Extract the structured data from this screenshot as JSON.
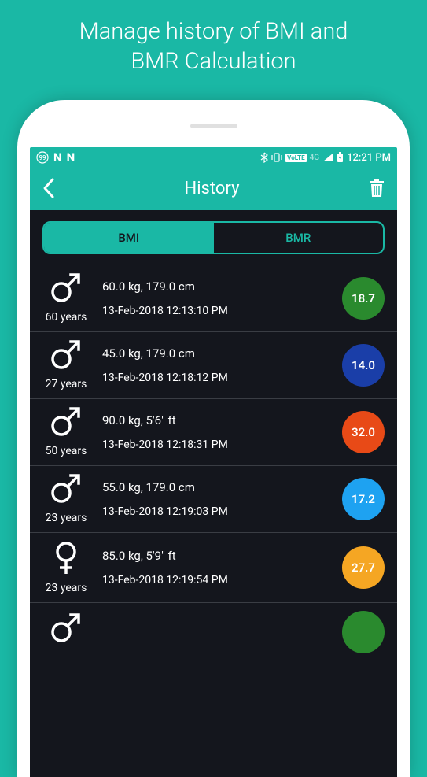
{
  "promo": {
    "line1": "Manage history of BMI and",
    "line2": "BMR Calculation"
  },
  "statusBar": {
    "badge99": "99",
    "fourG": "4G",
    "time": "12:21 PM"
  },
  "header": {
    "title": "History"
  },
  "tabs": {
    "bmi": "BMI",
    "bmr": "BMR"
  },
  "entries": [
    {
      "gender": "male",
      "age": "60 years",
      "measure": "60.0 kg, 179.0 cm",
      "date": "13-Feb-2018 12:13:10 PM",
      "value": "18.7",
      "color": "#2a8a2e"
    },
    {
      "gender": "male",
      "age": "27 years",
      "measure": "45.0 kg, 179.0 cm",
      "date": "13-Feb-2018 12:18:12 PM",
      "value": "14.0",
      "color": "#1a3ea8"
    },
    {
      "gender": "male",
      "age": "50 years",
      "measure": "90.0 kg, 5'6\" ft",
      "date": "13-Feb-2018 12:18:31 PM",
      "value": "32.0",
      "color": "#e84a17"
    },
    {
      "gender": "male",
      "age": "23 years",
      "measure": "55.0 kg, 179.0 cm",
      "date": "13-Feb-2018 12:19:03 PM",
      "value": "17.2",
      "color": "#1ea2f1"
    },
    {
      "gender": "female",
      "age": "23 years",
      "measure": "85.0 kg, 5'9\" ft",
      "date": "13-Feb-2018 12:19:54 PM",
      "value": "27.7",
      "color": "#f5a623"
    },
    {
      "gender": "male",
      "age": "",
      "measure": "",
      "date": "",
      "value": "",
      "color": "#2a8a2e"
    }
  ]
}
